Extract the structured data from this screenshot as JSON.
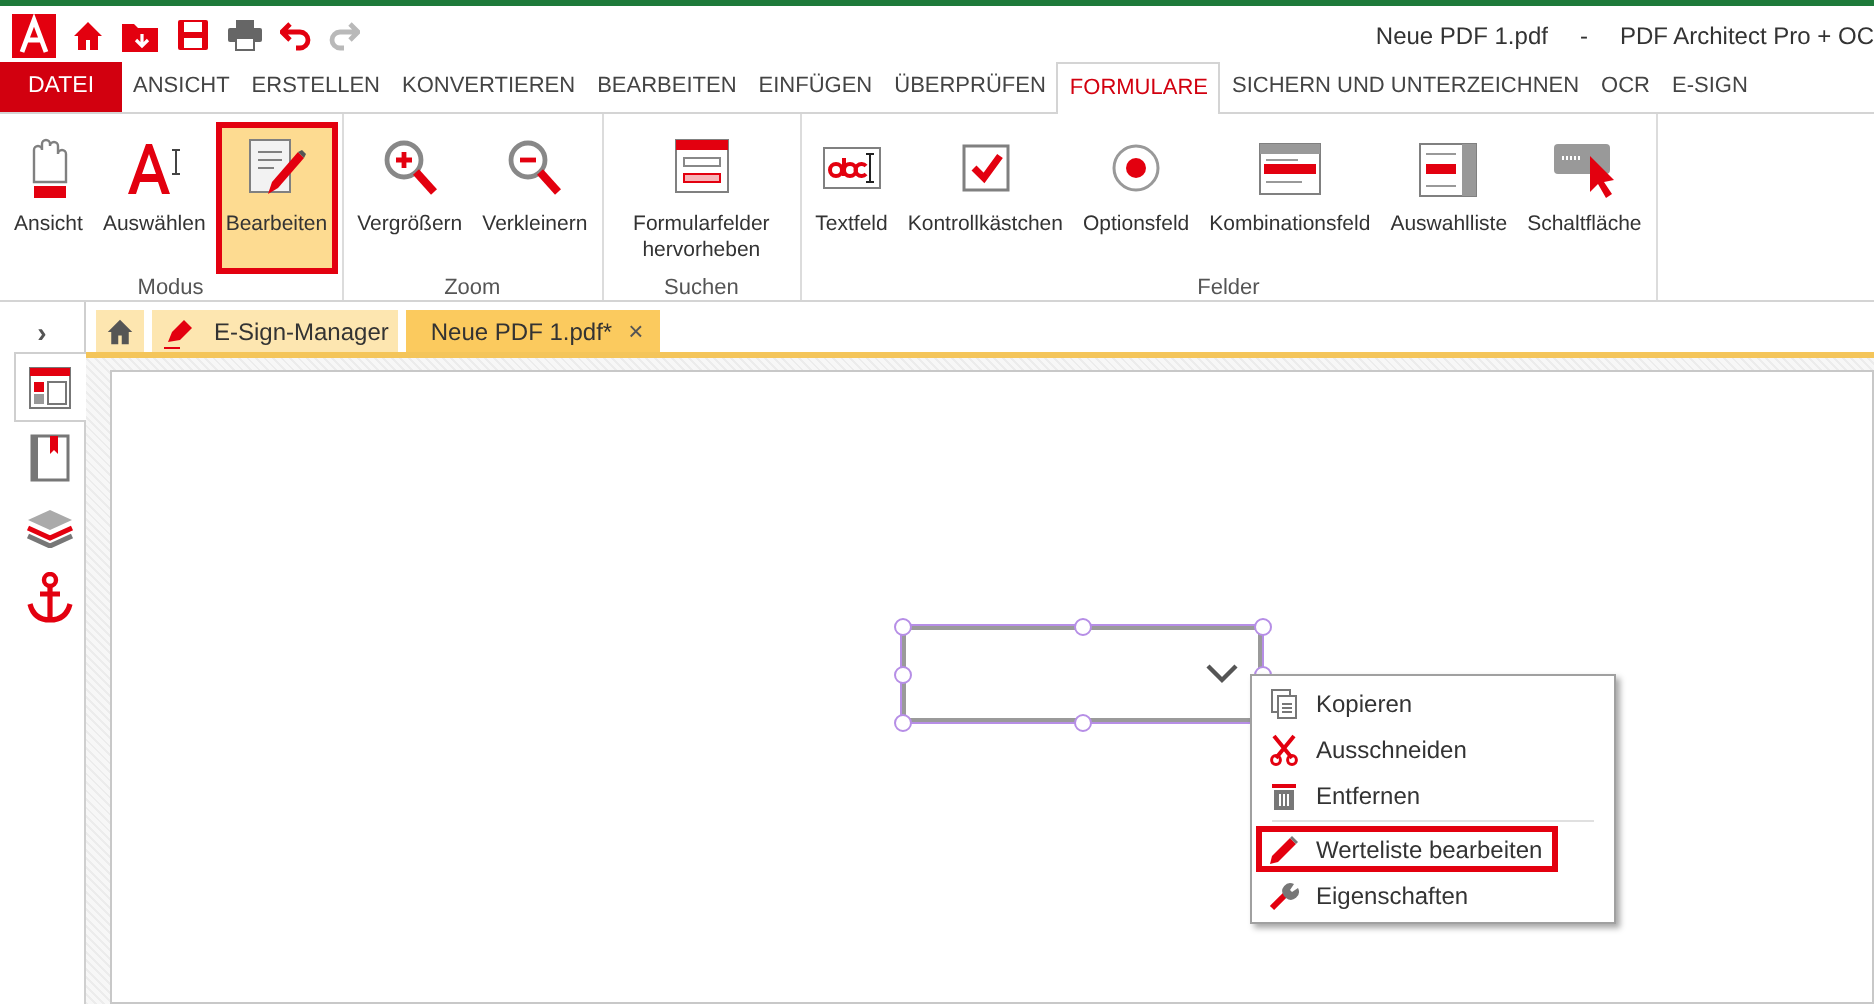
{
  "window": {
    "title": "Neue PDF 1.pdf",
    "separator": "-",
    "app_name": "PDF Architect Pro + OC"
  },
  "quick_access": [
    {
      "kind": "logo"
    },
    {
      "kind": "home"
    },
    {
      "kind": "open"
    },
    {
      "kind": "save"
    },
    {
      "kind": "print"
    },
    {
      "kind": "undo",
      "disabled": false
    },
    {
      "kind": "redo",
      "disabled": true
    }
  ],
  "menu_tabs": [
    {
      "label": "DATEI",
      "kind": "file",
      "selected": false
    },
    {
      "label": "ANSICHT",
      "kind": "tab",
      "selected": false
    },
    {
      "label": "ERSTELLEN",
      "kind": "tab",
      "selected": false
    },
    {
      "label": "KONVERTIEREN",
      "kind": "tab",
      "selected": false
    },
    {
      "label": "BEARBEITEN",
      "kind": "tab",
      "selected": false
    },
    {
      "label": "EINFÜGEN",
      "kind": "tab",
      "selected": false
    },
    {
      "label": "ÜBERPRÜFEN",
      "kind": "tab",
      "selected": false
    },
    {
      "label": "FORMULARE",
      "kind": "tab",
      "selected": true
    },
    {
      "label": "SICHERN UND UNTERZEICHNEN",
      "kind": "tab",
      "selected": false
    },
    {
      "label": "OCR",
      "kind": "tab",
      "selected": false
    },
    {
      "label": "E-SIGN",
      "kind": "tab",
      "selected": false
    }
  ],
  "ribbon_groups": [
    {
      "label": "Modus",
      "buttons": [
        {
          "label": "Ansicht",
          "kind": "hand",
          "selected": false
        },
        {
          "label": "Auswählen",
          "kind": "select",
          "selected": false
        },
        {
          "label": "Bearbeiten",
          "kind": "edit",
          "selected": true
        }
      ]
    },
    {
      "label": "Zoom",
      "buttons": [
        {
          "label": "Vergrößern",
          "kind": "zoom_in",
          "selected": false
        },
        {
          "label": "Verkleinern",
          "kind": "zoom_out",
          "selected": false
        }
      ]
    },
    {
      "label": "Suchen",
      "buttons": [
        {
          "label": "Formularfelder hervorheben",
          "kind": "highlight",
          "selected": false
        }
      ]
    },
    {
      "label": "Felder",
      "buttons": [
        {
          "label": "Textfeld",
          "kind": "textfield",
          "selected": false
        },
        {
          "label": "Kontrollkästchen",
          "kind": "checkbox",
          "selected": false
        },
        {
          "label": "Optionsfeld",
          "kind": "radio",
          "selected": false
        },
        {
          "label": "Kombinationsfeld",
          "kind": "combo",
          "selected": false
        },
        {
          "label": "Auswahlliste",
          "kind": "listbox",
          "selected": false
        },
        {
          "label": "Schaltfläche",
          "kind": "pushbutton",
          "selected": false
        }
      ]
    }
  ],
  "sidebar": {
    "toggle": "›",
    "items": [
      {
        "kind": "thumbnails",
        "selected": true
      },
      {
        "kind": "bookmarks",
        "selected": false
      },
      {
        "kind": "layers",
        "selected": false
      },
      {
        "kind": "anchor",
        "selected": false
      }
    ]
  },
  "document_tabs": [
    {
      "kind": "home",
      "selected": false
    },
    {
      "kind": "esign",
      "label": "E-Sign-Manager",
      "selected": false
    },
    {
      "kind": "document",
      "label": "Neue PDF 1.pdf*",
      "close": "×",
      "selected": true
    }
  ],
  "context_menu": {
    "items": [
      {
        "label": "Kopieren",
        "kind": "copy",
        "divider_before": false,
        "highlighted": false
      },
      {
        "label": "Ausschneiden",
        "kind": "cut",
        "divider_before": false,
        "highlighted": false
      },
      {
        "label": "Entfernen",
        "kind": "delete",
        "divider_before": false,
        "highlighted": false
      },
      {
        "label": "Werteliste bearbeiten",
        "kind": "edit",
        "divider_before": true,
        "highlighted": true
      },
      {
        "label": "Eigenschaften",
        "kind": "properties",
        "divider_before": false,
        "highlighted": false
      }
    ]
  }
}
